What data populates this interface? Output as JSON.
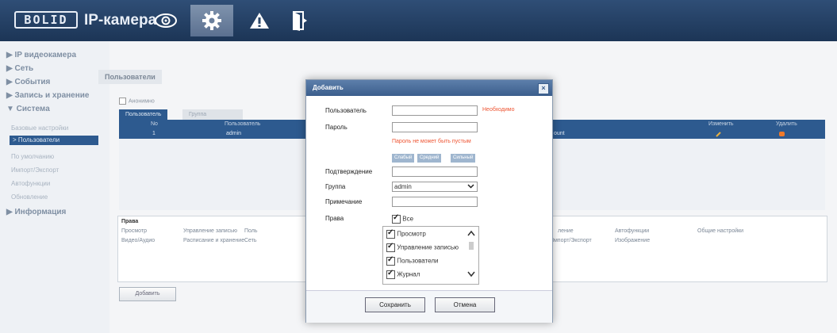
{
  "header": {
    "logo": "BOLID",
    "title": "IP-камера",
    "nav": [
      {
        "icon": "eye-icon"
      },
      {
        "icon": "gear-icon"
      },
      {
        "icon": "warning-icon"
      },
      {
        "icon": "exit-icon"
      }
    ]
  },
  "sidebar": {
    "sections": [
      "▶ IP видеокамера",
      "▶ Сеть",
      "▶ События",
      "▶ Запись и хранение",
      "▼ Система",
      "▶ Информация"
    ],
    "subitems": [
      "Базовые настройки",
      "> Пользователи",
      "По умолчанию",
      "Импорт/Экспорт",
      "Автофункции",
      "Обновление"
    ]
  },
  "main": {
    "breadcrumb": "Пользователи",
    "anonymous_label": "Анонимно",
    "tabs": [
      "Пользователь",
      "Группа"
    ],
    "table": {
      "headers": [
        "No",
        "Пользователь",
        "Изменить",
        "Удалить"
      ],
      "row": {
        "no": "1",
        "user": "admin",
        "name_fragment": "ount"
      }
    },
    "rights": {
      "title": "Права",
      "row1": [
        "Просмотр",
        "Управление записью",
        "Поль",
        "ление",
        "Автофункции",
        "Общие настройки"
      ],
      "row2": [
        "Видео/Аудио",
        "Расписание и хранение",
        "Сеть",
        "/Импорт/Экспорт",
        "Изображение"
      ]
    },
    "add_button": "Добавить"
  },
  "dialog": {
    "title": "Добавить",
    "close": "×",
    "labels": {
      "user": "Пользователь",
      "password": "Пароль",
      "confirm": "Подтверждение",
      "group": "Группа",
      "note": "Примечание",
      "rights": "Права"
    },
    "required": "Необходимо",
    "password_error": "Пароль не может быть пустым",
    "strength": [
      "Слабый",
      "Средний",
      "Сильный"
    ],
    "group_value": "admin",
    "all_label": "Все",
    "permissions": [
      "Просмотр",
      "Управление записью",
      "Пользователи",
      "Журнал"
    ],
    "save": "Сохранить",
    "cancel": "Отмена"
  }
}
